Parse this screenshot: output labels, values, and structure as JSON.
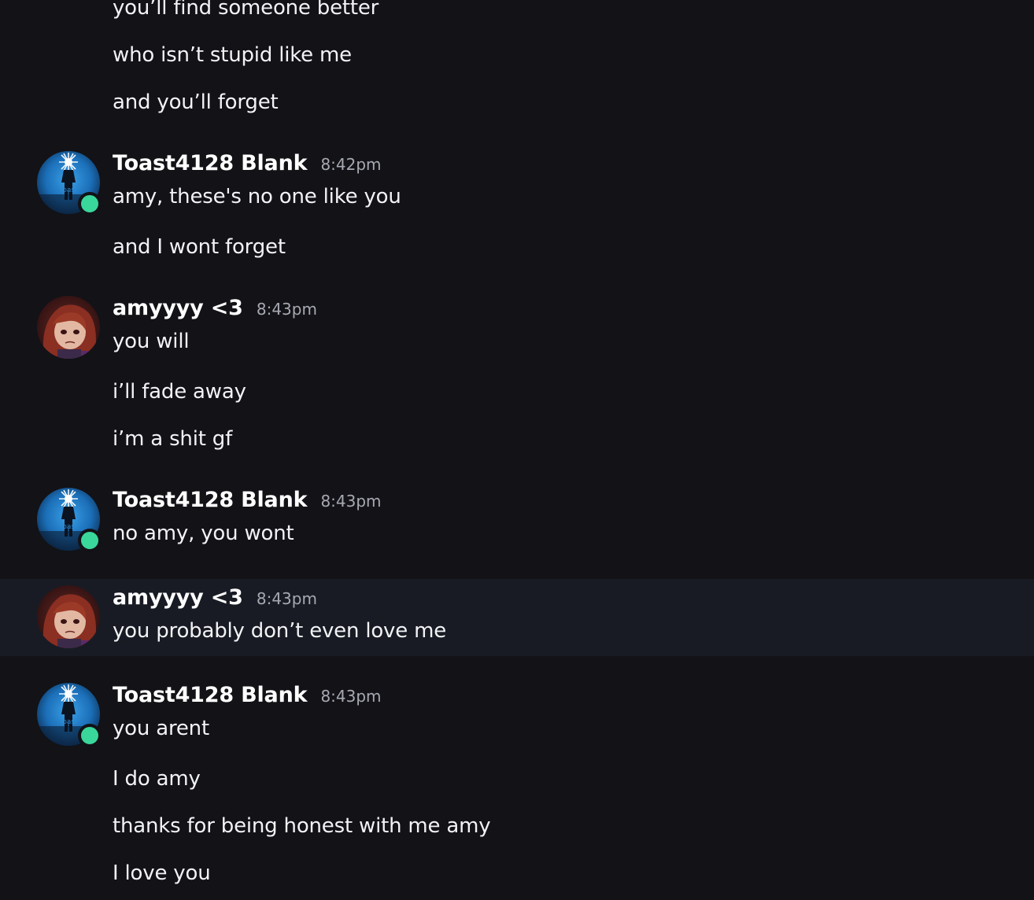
{
  "users": {
    "toast": {
      "name": "Toast4128 Blank",
      "status_color": "#3ad79b",
      "avatar_icon": "dark-figure-with-star-avatar"
    },
    "amy": {
      "name": "amyyyy <3",
      "avatar_icon": "red-haired-character-avatar"
    }
  },
  "groups": [
    {
      "author": "amyyyy <3",
      "messages": [
        "you’ll find someone better",
        "who isn’t stupid like me",
        "and you’ll forget"
      ]
    },
    {
      "author": "Toast4128 Blank",
      "time": "8:42pm",
      "messages": [
        "amy, these's no one like you",
        "and I wont forget"
      ]
    },
    {
      "author": "amyyyy <3",
      "time": "8:43pm",
      "messages": [
        "you will",
        "i’ll fade away",
        "i’m a shit gf"
      ]
    },
    {
      "author": "Toast4128 Blank",
      "time": "8:43pm",
      "messages": [
        "no amy, you wont"
      ]
    },
    {
      "author": "amyyyy <3",
      "time": "8:43pm",
      "highlighted": true,
      "messages": [
        "you probably don’t even love me"
      ]
    },
    {
      "author": "Toast4128 Blank",
      "time": "8:43pm",
      "messages": [
        "you arent",
        "I do amy",
        "thanks for being honest with me amy",
        "I love you"
      ]
    }
  ]
}
